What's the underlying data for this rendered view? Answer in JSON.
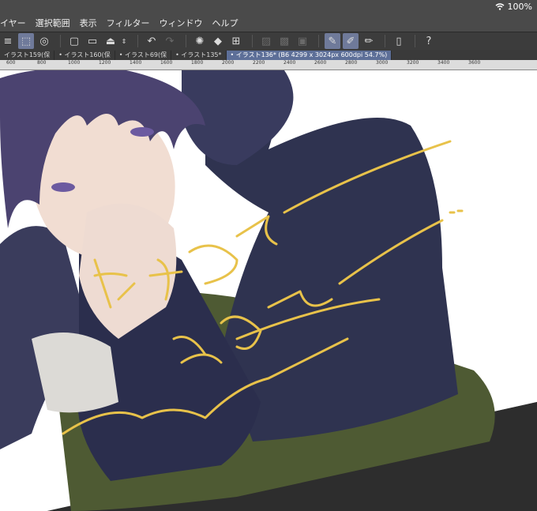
{
  "status": {
    "battery": "100%"
  },
  "menu": [
    "イヤー",
    "選択範囲",
    "表示",
    "フィルター",
    "ウィンドウ",
    "ヘルプ"
  ],
  "tabs": [
    {
      "label": "イラスト159(保"
    },
    {
      "label": "• イラスト160(保"
    },
    {
      "label": "• イラスト69(保"
    },
    {
      "label": "• イラスト135*"
    },
    {
      "label": "• イラスト136* (B6 4299 x 3024px 600dpi 54.7%)"
    }
  ],
  "ruler": [
    "600",
    "800",
    "1000",
    "1200",
    "1400",
    "1600",
    "1800",
    "2000",
    "2200",
    "2400",
    "2600",
    "2800",
    "3000",
    "3200",
    "3400",
    "3600"
  ],
  "toolbar_icons": [
    "menu-icon",
    "selection-tool-icon",
    "layer-icon",
    "new-canvas-icon",
    "open-folder-icon",
    "save-icon",
    "undo-icon",
    "redo-icon",
    "spinner-icon",
    "fill-icon",
    "transform-icon",
    "clear-icon",
    "fill-selection-icon",
    "crop-icon",
    "pen-icon",
    "brush-icon",
    "eraser-icon",
    "phone-icon",
    "help-icon"
  ],
  "colors": {
    "menubar": "#4a4a4a",
    "toolbar": "#3c3c3c",
    "active_tab": "#5d6f98",
    "handwriting": "#e8c24a"
  }
}
